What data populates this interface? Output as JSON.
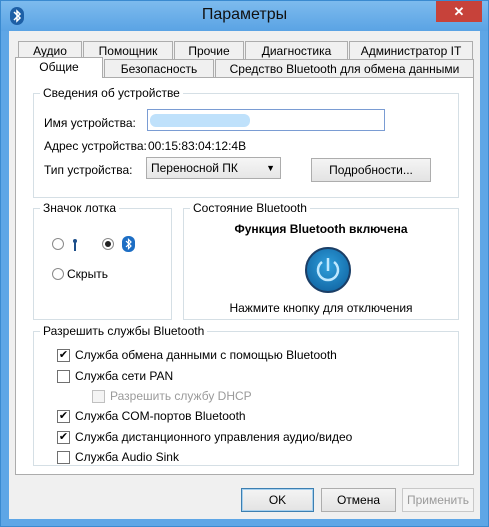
{
  "window": {
    "title": "Параметры",
    "close_glyph": "✕"
  },
  "tabs_row1": [
    "Аудио",
    "Помощник",
    "Прочие",
    "Диагностика",
    "Администратор IT"
  ],
  "tabs_row2": [
    "Общие",
    "Безопасность",
    "Средство Bluetooth для обмена данными"
  ],
  "device_info": {
    "group_title": "Сведения об устройстве",
    "name_label": "Имя устройства:",
    "name_value": "",
    "address_label": "Адрес устройства:",
    "address_value": "00:15:83:04:12:4B",
    "type_label": "Тип устройства:",
    "type_value": "Переносной ПК",
    "details_button": "Подробности..."
  },
  "tray_icon": {
    "group_title": "Значок лотка",
    "hide_label": "Скрыть",
    "selected": "bluetooth"
  },
  "bt_state": {
    "group_title": "Состояние Bluetooth",
    "status": "Функция Bluetooth включена",
    "hint": "Нажмите кнопку для отключения"
  },
  "services": {
    "group_title": "Разрешить службы Bluetooth",
    "items": [
      {
        "label": "Служба обмена данными с помощью Bluetooth",
        "checked": true,
        "enabled": true
      },
      {
        "label": "Служба сети PAN",
        "checked": false,
        "enabled": true
      },
      {
        "label": "Разрешить службу DHCP",
        "checked": false,
        "enabled": false
      },
      {
        "label": "Служба COM-портов Bluetooth",
        "checked": true,
        "enabled": true
      },
      {
        "label": "Служба дистанционного управления аудио/видео",
        "checked": true,
        "enabled": true
      },
      {
        "label": "Служба Audio Sink",
        "checked": false,
        "enabled": true
      }
    ]
  },
  "buttons": {
    "ok": "OK",
    "cancel": "Отмена",
    "apply": "Применить"
  },
  "glyphs": {
    "check": "✔",
    "arrow": "▼",
    "bluetooth": "ᛒ"
  },
  "colors": {
    "title_bar": "#5aa3e4",
    "close": "#c7423a",
    "power_button": "#0c5b99"
  }
}
